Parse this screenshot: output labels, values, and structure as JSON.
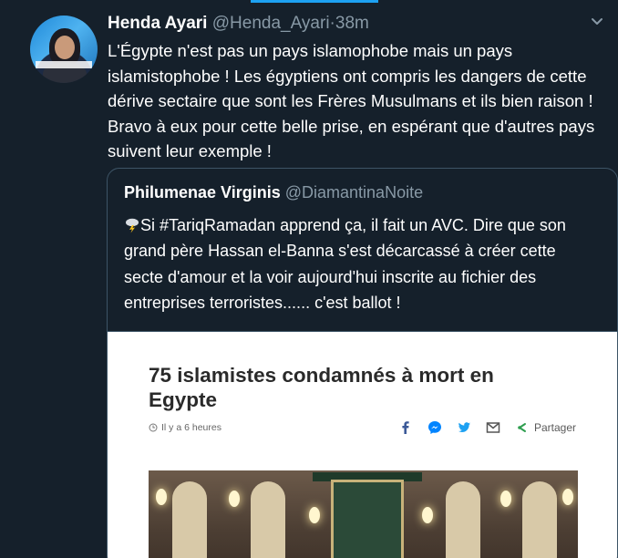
{
  "tweet": {
    "author_name": "Henda Ayari",
    "author_handle": "@Henda_Ayari",
    "separator": "·",
    "time": "38m",
    "lines": [
      "L'Égypte n'est pas un pays islamophobe mais un pays",
      "islamistophobe ! Les égyptiens ont  compris les dangers de cette",
      "dérive sectaire que sont les Frères Musulmans et ils bien raison !",
      "Bravo à eux pour cette belle prise, en espérant que d'autres pays",
      "suivent leur exemple !"
    ]
  },
  "quote": {
    "author_name": "Philumenae Virginis",
    "author_handle": "@DiamantinaNoite",
    "emoji": "lightning-cloud",
    "lines": [
      "Si #TariqRamadan apprend ça, il fait un AVC. Dire que son",
      "grand père Hassan el-Banna s'est décarcassé à créer cette",
      "secte d'amour et la voir aujourd'hui inscrite au fichier des",
      "entreprises terroristes...... c'est ballot !"
    ],
    "article": {
      "title_lines": [
        "75 islamistes condamnés à mort en",
        "Egypte"
      ],
      "meta": "Il y a 6 heures",
      "share_label": "Partager",
      "colors": {
        "facebook": "#3b5998",
        "messenger": "#0084ff",
        "twitter": "#1da1f2",
        "mail": "#555555",
        "share": "#2e9e4f"
      }
    }
  },
  "colors": {
    "background": "#15202b",
    "secondary_text": "#8899a6",
    "accent": "#1da1f2",
    "border": "#3d5466"
  }
}
